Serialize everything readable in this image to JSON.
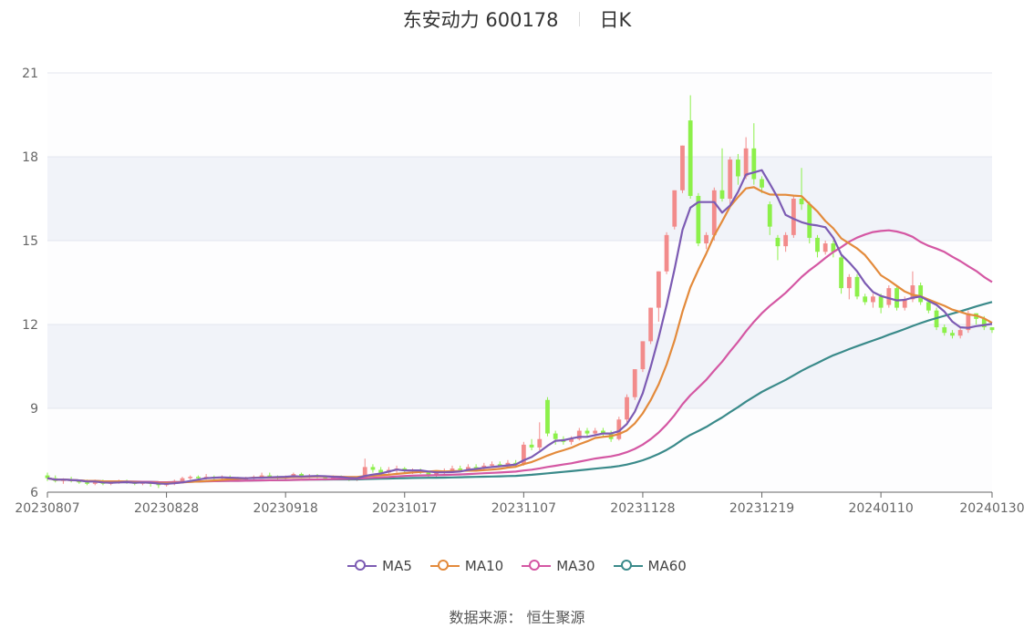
{
  "header": {
    "name": "东安动力 600178",
    "period": "日K"
  },
  "footer": {
    "source": "数据来源： 恒生聚源"
  },
  "colors": {
    "up": "#f28b8b",
    "down": "#8cf04a",
    "band": "#f1f3f9",
    "grid": "#e3e6ef",
    "ma5": "#7c5bb3",
    "ma10": "#e38a3b",
    "ma30": "#d457a3",
    "ma60": "#3a8a8a"
  },
  "chart_data": {
    "type": "candlestick",
    "y_ticks": [
      6,
      9,
      12,
      15,
      18,
      21
    ],
    "ylim": [
      6,
      21
    ],
    "x_ticks": [
      "20230807",
      "20230828",
      "20230918",
      "20231017",
      "20231107",
      "20231128",
      "20231219",
      "20240110",
      "20240130"
    ],
    "tick_index": [
      0,
      15,
      30,
      45,
      60,
      75,
      90,
      105,
      119
    ],
    "legend": [
      "MA5",
      "MA10",
      "MA30",
      "MA60"
    ],
    "candles": [
      [
        6.6,
        6.5,
        6.7,
        6.4
      ],
      [
        6.5,
        6.4,
        6.6,
        6.35
      ],
      [
        6.4,
        6.45,
        6.5,
        6.3
      ],
      [
        6.45,
        6.4,
        6.55,
        6.35
      ],
      [
        6.4,
        6.35,
        6.45,
        6.3
      ],
      [
        6.35,
        6.3,
        6.45,
        6.25
      ],
      [
        6.3,
        6.4,
        6.45,
        6.25
      ],
      [
        6.4,
        6.3,
        6.45,
        6.25
      ],
      [
        6.3,
        6.35,
        6.4,
        6.25
      ],
      [
        6.35,
        6.4,
        6.45,
        6.3
      ],
      [
        6.4,
        6.35,
        6.45,
        6.3
      ],
      [
        6.35,
        6.3,
        6.4,
        6.25
      ],
      [
        6.3,
        6.35,
        6.4,
        6.25
      ],
      [
        6.35,
        6.3,
        6.4,
        6.2
      ],
      [
        6.3,
        6.25,
        6.35,
        6.15
      ],
      [
        6.25,
        6.3,
        6.35,
        6.2
      ],
      [
        6.3,
        6.4,
        6.45,
        6.25
      ],
      [
        6.4,
        6.5,
        6.55,
        6.35
      ],
      [
        6.5,
        6.55,
        6.6,
        6.45
      ],
      [
        6.55,
        6.5,
        6.6,
        6.45
      ],
      [
        6.5,
        6.55,
        6.65,
        6.45
      ],
      [
        6.55,
        6.5,
        6.6,
        6.45
      ],
      [
        6.5,
        6.55,
        6.6,
        6.45
      ],
      [
        6.55,
        6.5,
        6.6,
        6.4
      ],
      [
        6.5,
        6.45,
        6.55,
        6.4
      ],
      [
        6.45,
        6.5,
        6.55,
        6.4
      ],
      [
        6.5,
        6.55,
        6.6,
        6.45
      ],
      [
        6.55,
        6.6,
        6.7,
        6.5
      ],
      [
        6.6,
        6.55,
        6.7,
        6.5
      ],
      [
        6.55,
        6.5,
        6.6,
        6.45
      ],
      [
        6.5,
        6.55,
        6.6,
        6.45
      ],
      [
        6.55,
        6.65,
        6.7,
        6.5
      ],
      [
        6.65,
        6.55,
        6.7,
        6.5
      ],
      [
        6.55,
        6.6,
        6.65,
        6.5
      ],
      [
        6.6,
        6.55,
        6.65,
        6.5
      ],
      [
        6.55,
        6.5,
        6.6,
        6.45
      ],
      [
        6.5,
        6.55,
        6.6,
        6.45
      ],
      [
        6.55,
        6.5,
        6.6,
        6.45
      ],
      [
        6.5,
        6.45,
        6.55,
        6.4
      ],
      [
        6.45,
        6.5,
        6.55,
        6.4
      ],
      [
        6.5,
        6.9,
        7.2,
        6.45
      ],
      [
        6.9,
        6.8,
        7.0,
        6.7
      ],
      [
        6.8,
        6.7,
        6.9,
        6.6
      ],
      [
        6.7,
        6.8,
        6.9,
        6.65
      ],
      [
        6.8,
        6.85,
        6.95,
        6.7
      ],
      [
        6.85,
        6.75,
        6.9,
        6.7
      ],
      [
        6.75,
        6.8,
        6.85,
        6.65
      ],
      [
        6.8,
        6.7,
        6.85,
        6.65
      ],
      [
        6.7,
        6.6,
        6.75,
        6.55
      ],
      [
        6.6,
        6.7,
        6.75,
        6.55
      ],
      [
        6.7,
        6.75,
        6.85,
        6.65
      ],
      [
        6.75,
        6.85,
        6.95,
        6.7
      ],
      [
        6.85,
        6.8,
        6.95,
        6.75
      ],
      [
        6.8,
        6.9,
        7.0,
        6.75
      ],
      [
        6.9,
        6.85,
        7.0,
        6.8
      ],
      [
        6.85,
        6.95,
        7.05,
        6.8
      ],
      [
        6.95,
        7.0,
        7.1,
        6.9
      ],
      [
        7.0,
        6.95,
        7.1,
        6.9
      ],
      [
        6.95,
        7.05,
        7.15,
        6.9
      ],
      [
        7.05,
        7.0,
        7.15,
        6.95
      ],
      [
        7.0,
        7.7,
        7.8,
        6.95
      ],
      [
        7.7,
        7.6,
        7.9,
        7.5
      ],
      [
        7.6,
        7.9,
        8.5,
        7.5
      ],
      [
        9.3,
        8.1,
        9.4,
        8.0
      ],
      [
        8.1,
        7.9,
        8.2,
        7.7
      ],
      [
        7.9,
        7.8,
        8.0,
        7.7
      ],
      [
        7.8,
        7.9,
        8.0,
        7.7
      ],
      [
        7.9,
        8.2,
        8.3,
        7.85
      ],
      [
        8.2,
        8.1,
        8.3,
        8.0
      ],
      [
        8.1,
        8.2,
        8.3,
        8.0
      ],
      [
        8.2,
        8.1,
        8.3,
        8.0
      ],
      [
        8.1,
        7.9,
        8.2,
        7.8
      ],
      [
        7.9,
        8.6,
        8.7,
        7.85
      ],
      [
        8.6,
        9.4,
        9.5,
        8.5
      ],
      [
        9.4,
        10.4,
        10.4,
        9.3
      ],
      [
        10.4,
        11.4,
        11.4,
        10.3
      ],
      [
        11.4,
        12.6,
        12.6,
        11.3
      ],
      [
        12.6,
        13.9,
        13.9,
        12.1
      ],
      [
        13.9,
        15.2,
        15.3,
        13.8
      ],
      [
        15.5,
        16.8,
        16.8,
        15.4
      ],
      [
        16.8,
        18.4,
        18.4,
        16.7
      ],
      [
        19.3,
        16.6,
        20.2,
        16.5
      ],
      [
        16.6,
        14.9,
        16.7,
        14.8
      ],
      [
        14.9,
        15.2,
        15.3,
        14.7
      ],
      [
        15.2,
        16.8,
        16.9,
        15.0
      ],
      [
        16.8,
        16.5,
        18.3,
        16.4
      ],
      [
        16.5,
        17.9,
        18.0,
        16.2
      ],
      [
        17.9,
        17.3,
        18.1,
        17.0
      ],
      [
        17.3,
        18.3,
        18.7,
        17.2
      ],
      [
        18.3,
        17.2,
        19.2,
        17.0
      ],
      [
        17.2,
        16.9,
        17.3,
        16.7
      ],
      [
        16.3,
        15.5,
        16.4,
        15.2
      ],
      [
        15.1,
        14.8,
        15.2,
        14.3
      ],
      [
        14.8,
        15.2,
        15.3,
        14.6
      ],
      [
        15.2,
        16.5,
        16.6,
        15.1
      ],
      [
        16.5,
        16.3,
        17.6,
        16.1
      ],
      [
        16.3,
        15.1,
        16.4,
        14.9
      ],
      [
        15.1,
        14.6,
        15.2,
        14.4
      ],
      [
        14.6,
        14.9,
        15.0,
        14.5
      ],
      [
        14.9,
        14.6,
        15.0,
        14.4
      ],
      [
        14.4,
        13.3,
        14.5,
        13.1
      ],
      [
        13.3,
        13.7,
        13.8,
        12.9
      ],
      [
        13.7,
        13.0,
        13.8,
        12.9
      ],
      [
        13.0,
        12.8,
        13.1,
        12.7
      ],
      [
        12.8,
        13.0,
        13.1,
        12.6
      ],
      [
        13.0,
        12.6,
        13.1,
        12.4
      ],
      [
        12.7,
        13.3,
        13.4,
        12.6
      ],
      [
        13.3,
        12.6,
        13.4,
        12.5
      ],
      [
        12.6,
        12.9,
        13.0,
        12.5
      ],
      [
        12.9,
        13.4,
        13.9,
        12.8
      ],
      [
        13.4,
        12.8,
        13.5,
        12.7
      ],
      [
        12.8,
        12.5,
        12.9,
        12.4
      ],
      [
        12.5,
        11.9,
        12.6,
        11.8
      ],
      [
        11.9,
        11.7,
        12.0,
        11.6
      ],
      [
        11.7,
        11.6,
        11.8,
        11.5
      ],
      [
        11.6,
        11.8,
        11.9,
        11.5
      ],
      [
        11.8,
        12.4,
        12.5,
        11.7
      ],
      [
        12.4,
        12.2,
        12.4,
        12.0
      ],
      [
        12.2,
        11.9,
        12.3,
        11.8
      ],
      [
        11.9,
        11.8,
        11.9,
        11.7
      ]
    ]
  }
}
